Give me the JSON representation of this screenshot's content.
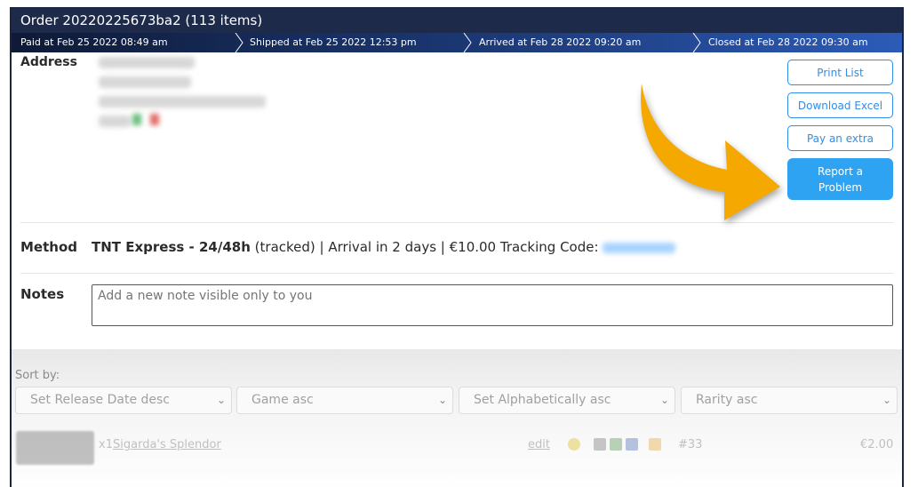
{
  "order": {
    "title": "Order 20220225673ba2 (113 items)"
  },
  "timeline": [
    {
      "label": "Paid at Feb 25 2022 08:49 am"
    },
    {
      "label": "Shipped at Feb 25 2022 12:53 pm"
    },
    {
      "label": "Arrived at Feb 28 2022 09:20 am"
    },
    {
      "label": "Closed at Feb 28 2022 09:30 am"
    }
  ],
  "address": {
    "label": "Address"
  },
  "actions": {
    "print_list": "Print List",
    "download_excel": "Download Excel",
    "pay_extra": "Pay an extra",
    "report_problem": "Report a Problem"
  },
  "method": {
    "label": "Method",
    "carrier": "TNT Express - 24/48h",
    "details": " (tracked) | Arrival in 2 days | €10.00 Tracking Code:"
  },
  "notes": {
    "label": "Notes",
    "placeholder": "Add a new note visible only to you"
  },
  "sort": {
    "label": "Sort by:",
    "options": [
      "Set Release Date desc",
      "Game asc",
      "Set Alphabetically asc",
      "Rarity asc"
    ]
  },
  "item_row": {
    "qty": "x1",
    "name": "Sigarda's Splendor",
    "edit": "edit",
    "number": "#33",
    "price": "€2.00"
  },
  "colors": {
    "title_bar": "#1d2a4a",
    "accent": "#2ea3f2",
    "arrow": "#f5a800"
  },
  "icons": {
    "arrow": "pointer-arrow-icon",
    "chevron": "chevron-down-icon"
  }
}
